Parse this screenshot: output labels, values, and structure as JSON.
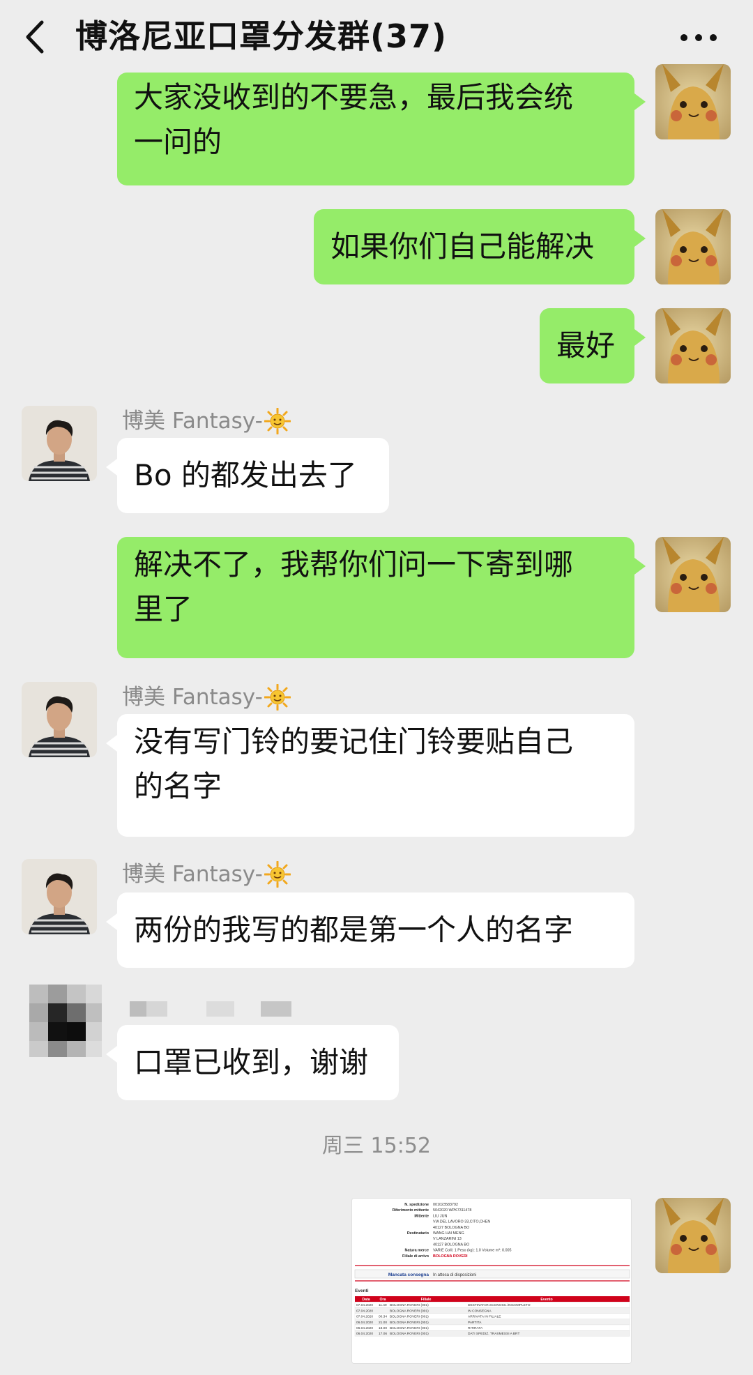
{
  "header": {
    "title": "博洛尼亚口罩分发群(37)",
    "back_icon": "chevron-left-icon",
    "more_icon": "more-dots-icon"
  },
  "messages": [
    {
      "side": "right",
      "lines": [
        "大家没收到的不要急，最后我会统",
        "一问的"
      ]
    },
    {
      "side": "right",
      "lines": [
        "如果你们自己能解决"
      ]
    },
    {
      "side": "right",
      "lines": [
        "最好"
      ]
    },
    {
      "side": "left",
      "sender": "博美 Fantasy-",
      "lines": [
        "Bo 的都发出去了"
      ]
    },
    {
      "side": "right",
      "lines": [
        "解决不了，我帮你们问一下寄到哪",
        "里了"
      ]
    },
    {
      "side": "left",
      "sender": "博美 Fantasy-",
      "lines": [
        "没有写门铃的要记住门铃要贴自己",
        "的名字"
      ]
    },
    {
      "side": "left",
      "sender": "博美 Fantasy-",
      "lines": [
        "两份的我写的都是第一个人的名字"
      ]
    },
    {
      "side": "left",
      "sender": "",
      "lines": [
        "口罩已收到，谢谢"
      ]
    }
  ],
  "timestamp": "周三 15:52",
  "shared_image": {
    "fields": [
      {
        "label": "N. spedizione",
        "value": "001023583792"
      },
      {
        "label": "Riferimento mittente",
        "value": "5042020 WPK7311478"
      },
      {
        "label": "Mittente",
        "value": "LIU JUN"
      },
      {
        "label": "",
        "value": "VIA DEL LAVORO 33,CITO,CHEN"
      },
      {
        "label": "",
        "value": "40127 BOLOGNA BO"
      },
      {
        "label": "Destinatario",
        "value": "WANG HAI MENG"
      },
      {
        "label": "",
        "value": "V LANZARINI 13"
      },
      {
        "label": "",
        "value": "40127 BOLOGNA BO"
      },
      {
        "label": "Natura merce",
        "value": "VARIE   Colli: 1   Peso (kg): 1.0   Volume m³: 0.005"
      },
      {
        "label": "Filiale di arrivo",
        "value": "BOLOGNA ROVERI"
      }
    ],
    "status_label": "Mancata consegna",
    "status_value": "In attesa di disposizioni",
    "events_title": "Eventi",
    "columns": [
      "Data",
      "Ora",
      "Filiale",
      "Evento"
    ],
    "rows": [
      [
        "07.04.2020",
        "11.49",
        "BOLOGNA ROVERI (001)",
        "DESTINATAR.SCONOSC./INCOMPLETO"
      ],
      [
        "07.04.2020",
        "",
        "BOLOGNA ROVERI (001)",
        "IN CONSEGNA"
      ],
      [
        "07.04.2020",
        "00.34",
        "BOLOGNA ROVERI (001)",
        "ARRIVATA IN FILIALE"
      ],
      [
        "06.04.2020",
        "21.00",
        "BOLOGNA ROVERI (001)",
        "PARTITA"
      ],
      [
        "06.04.2020",
        "18.00",
        "BOLOGNA ROVERI (001)",
        "RITIRATA"
      ],
      [
        "06.04.2020",
        "17.06",
        "BOLOGNA ROVERI (001)",
        "DATI SPEDIZ. TRASMESSI A BRT"
      ]
    ]
  },
  "colors": {
    "background": "#ededed",
    "bubble_self": "#95ec69",
    "bubble_other": "#ffffff",
    "sender_name": "#8a8a8a",
    "table_header": "#d0021b"
  }
}
